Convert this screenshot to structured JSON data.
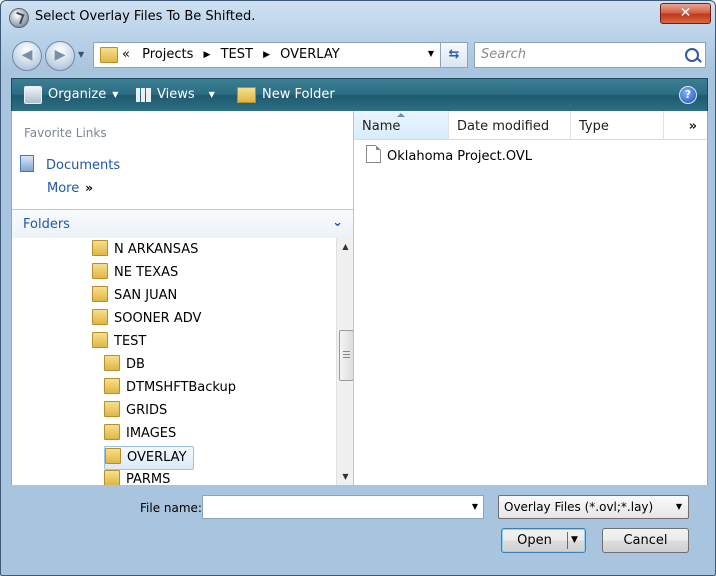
{
  "window": {
    "title": "Select Overlay Files To Be Shifted.",
    "close_label": "✕"
  },
  "address": {
    "overflow": "«",
    "crumbs": [
      "Projects",
      "TEST",
      "OVERLAY"
    ],
    "separator": "▶"
  },
  "search": {
    "placeholder": "Search"
  },
  "toolbar": {
    "organize": "Organize",
    "views": "Views",
    "new_folder": "New Folder",
    "help": "?"
  },
  "favorites": {
    "header": "Favorite Links",
    "documents": "Documents",
    "more": "More",
    "more_chevron": "»"
  },
  "folders": {
    "header": "Folders",
    "chevron": "⌄",
    "items": [
      {
        "label": "N ARKANSAS",
        "level": 0
      },
      {
        "label": "NE TEXAS",
        "level": 0
      },
      {
        "label": "SAN JUAN",
        "level": 0
      },
      {
        "label": "SOONER ADV",
        "level": 0
      },
      {
        "label": "TEST",
        "level": 0
      },
      {
        "label": "DB",
        "level": 1
      },
      {
        "label": "DTMSHFTBackup",
        "level": 1
      },
      {
        "label": "GRIDS",
        "level": 1
      },
      {
        "label": "IMAGES",
        "level": 1
      },
      {
        "label": "OVERLAY",
        "level": 1,
        "selected": true
      },
      {
        "label": "PARMS",
        "level": 1
      }
    ]
  },
  "file_list": {
    "columns": [
      "Name",
      "Date modified",
      "Type"
    ],
    "more": "»",
    "files": [
      "Oklahoma Project.OVL"
    ]
  },
  "bottom": {
    "file_name_label": "File name:",
    "file_name_value": "",
    "filter": "Overlay Files (*.ovl;*.lay)",
    "open": "Open",
    "cancel": "Cancel"
  }
}
